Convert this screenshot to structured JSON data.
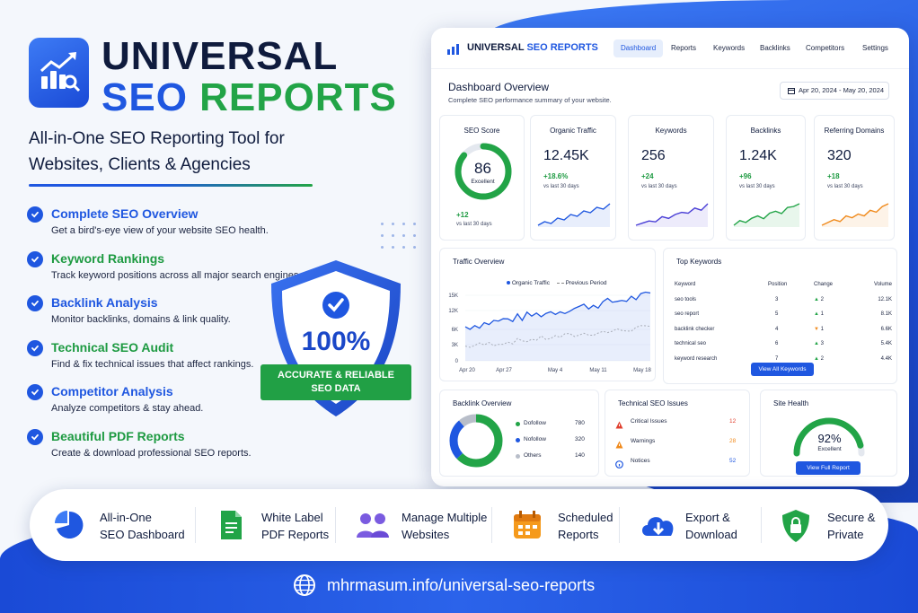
{
  "brand": {
    "line1": "UNIVERSAL",
    "line2_seo": "SEO",
    "line2_reports": "REPORTS",
    "tagline_line1": "All-in-One SEO Reporting Tool for",
    "tagline_line2": "Websites, Clients & Agencies"
  },
  "colors": {
    "blue": "#1f57e0",
    "green": "#22a447",
    "navy": "#0f1b3d",
    "orange": "#f08a1c",
    "red": "#e0402f"
  },
  "features": [
    {
      "title": "Complete SEO Overview",
      "desc": "Get a bird's-eye view of your website SEO health.",
      "color": "blue",
      "icon": "check-circle-icon"
    },
    {
      "title": "Keyword Rankings",
      "desc": "Track keyword positions across all major search engines.",
      "color": "green",
      "icon": "check-circle-icon"
    },
    {
      "title": "Backlink Analysis",
      "desc": "Monitor backlinks, domains & link quality.",
      "color": "blue",
      "icon": "check-circle-icon"
    },
    {
      "title": "Technical SEO Audit",
      "desc": "Find & fix technical issues that affect rankings.",
      "color": "green",
      "icon": "check-circle-icon"
    },
    {
      "title": "Competitor Analysis",
      "desc": "Analyze competitors & stay ahead.",
      "color": "blue",
      "icon": "check-circle-icon"
    },
    {
      "title": "Beautiful PDF Reports",
      "desc": "Create & download professional SEO reports.",
      "color": "green",
      "icon": "check-circle-icon"
    }
  ],
  "badge": {
    "percent": "100%",
    "ribbon_line1": "ACCURATE & RELIABLE",
    "ribbon_line2": "SEO DATA"
  },
  "dashboard": {
    "brand_universal": "UNIVERSAL",
    "brand_seo": "SEO REPORTS",
    "nav": [
      "Dashboard",
      "Reports",
      "Keywords",
      "Backlinks",
      "Competitors",
      "Settings"
    ],
    "active_nav": "Dashboard",
    "title": "Dashboard Overview",
    "subtitle": "Complete SEO performance summary of your website.",
    "date_range": "Apr 20, 2024 - May 20, 2024",
    "seo_score": {
      "label": "SEO Score",
      "value": "86",
      "rating": "Excellent",
      "change": "+12",
      "period": "vs last 30 days",
      "fraction": 0.86
    },
    "metrics": [
      {
        "label": "Organic Traffic",
        "value": "12.45K",
        "change": "+18.6%",
        "period": "vs last 30 days",
        "color": "#1f57e0",
        "trend": [
          3,
          4,
          3.5,
          5,
          4.5,
          6,
          5.5,
          7,
          6.5,
          8,
          7.5,
          9
        ]
      },
      {
        "label": "Keywords",
        "value": "256",
        "change": "+24",
        "period": "vs last 30 days",
        "color": "#4a3fd6",
        "trend": [
          3,
          3.5,
          4,
          3.8,
          5,
          4.6,
          5.5,
          6,
          5.8,
          7,
          6.5,
          8
        ]
      },
      {
        "label": "Backlinks",
        "value": "1.24K",
        "change": "+96",
        "period": "vs last 30 days",
        "color": "#22a447",
        "trend": [
          3,
          4,
          3.6,
          4.5,
          5,
          4.4,
          5.6,
          6,
          5.5,
          6.8,
          7,
          7.6
        ]
      },
      {
        "label": "Referring Domains",
        "value": "320",
        "change": "+18",
        "period": "vs last 30 days",
        "color": "#f08a1c",
        "trend": [
          3,
          3.6,
          4.2,
          3.8,
          5,
          4.6,
          5.4,
          5,
          6.2,
          5.8,
          7,
          7.6
        ]
      }
    ],
    "traffic": {
      "title": "Traffic Overview",
      "legend_organic": "Organic Traffic",
      "legend_previous": "Previous Period",
      "y_ticks": [
        "15K",
        "12K",
        "6K",
        "3K",
        "0"
      ],
      "x_ticks": [
        "Apr 20",
        "Apr 27",
        "May 4",
        "May 11",
        "May 18"
      ]
    },
    "top_keywords": {
      "title": "Top Keywords",
      "headers": [
        "Keyword",
        "Position",
        "Change",
        "Volume"
      ],
      "rows": [
        {
          "keyword": "seo tools",
          "position": "3",
          "change": "2",
          "dir": "up",
          "volume": "12.1K"
        },
        {
          "keyword": "seo report",
          "position": "5",
          "change": "1",
          "dir": "up",
          "volume": "8.1K"
        },
        {
          "keyword": "backlink checker",
          "position": "4",
          "change": "1",
          "dir": "down",
          "volume": "6.6K"
        },
        {
          "keyword": "technical seo",
          "position": "6",
          "change": "3",
          "dir": "up",
          "volume": "5.4K"
        },
        {
          "keyword": "keyword research",
          "position": "7",
          "change": "2",
          "dir": "up",
          "volume": "4.4K"
        }
      ],
      "button": "View All Keywords"
    },
    "backlink_overview": {
      "title": "Backlink Overview",
      "items": [
        {
          "label": "Dofollow",
          "value": "780",
          "color": "#22a447"
        },
        {
          "label": "Nofollow",
          "value": "320",
          "color": "#1f57e0"
        },
        {
          "label": "Others",
          "value": "140",
          "color": "#b8bec9"
        }
      ]
    },
    "tech_issues": {
      "title": "Technical SEO Issues",
      "items": [
        {
          "label": "Critical Issues",
          "value": "12",
          "color": "#e0402f",
          "icon": "warning-icon"
        },
        {
          "label": "Warnings",
          "value": "28",
          "color": "#f08a1c",
          "icon": "warning-icon"
        },
        {
          "label": "Notices",
          "value": "52",
          "color": "#1f57e0",
          "icon": "info-icon"
        }
      ]
    },
    "site_health": {
      "title": "Site Health",
      "value": "92%",
      "rating": "Excellent",
      "fraction": 0.92,
      "button": "View Full Report"
    }
  },
  "bottom_features": [
    {
      "line1": "All-in-One",
      "line2": "SEO Dashboard",
      "icon": "pie-chart-icon"
    },
    {
      "line1": "White Label",
      "line2": "PDF Reports",
      "icon": "document-icon"
    },
    {
      "line1": "Manage Multiple",
      "line2": "Websites",
      "icon": "users-icon"
    },
    {
      "line1": "Scheduled",
      "line2": "Reports",
      "icon": "calendar-icon"
    },
    {
      "line1": "Export &",
      "line2": "Download",
      "icon": "cloud-download-icon"
    },
    {
      "line1": "Secure &",
      "line2": "Private",
      "icon": "shield-lock-icon"
    }
  ],
  "url": "mhrmasum.info/universal-seo-reports"
}
